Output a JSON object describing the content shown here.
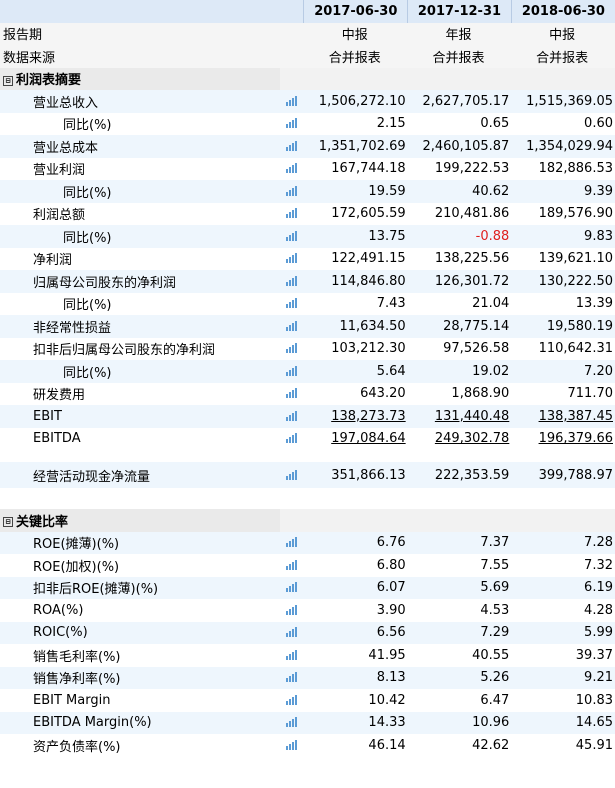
{
  "header": {
    "label": "报告期",
    "dates": [
      "2017-06-30",
      "2017-12-31",
      "2018-06-30"
    ]
  },
  "report_type": {
    "label": "报告期",
    "values": [
      "中报",
      "年报",
      "中报"
    ]
  },
  "data_source": {
    "label": "数据来源",
    "values": [
      "合并报表",
      "合并报表",
      "合并报表"
    ]
  },
  "income_section": {
    "toggle": "⊟",
    "title": "利润表摘要",
    "rows": [
      {
        "label": "营业总收入",
        "values": [
          "1,506,272.10",
          "2,627,705.17",
          "1,515,369.05"
        ]
      },
      {
        "label": "同比(%)",
        "values": [
          "2.15",
          "0.65",
          "0.60"
        ]
      },
      {
        "label": "营业总成本",
        "values": [
          "1,351,702.69",
          "2,460,105.87",
          "1,354,029.94"
        ]
      },
      {
        "label": "营业利润",
        "values": [
          "167,744.18",
          "199,222.53",
          "182,886.53"
        ]
      },
      {
        "label": "同比(%)",
        "values": [
          "19.59",
          "40.62",
          "9.39"
        ]
      },
      {
        "label": "利润总额",
        "values": [
          "172,605.59",
          "210,481.86",
          "189,576.90"
        ]
      },
      {
        "label": "同比(%)",
        "values": [
          "13.75",
          "-0.88",
          "9.83"
        ]
      },
      {
        "label": "净利润",
        "values": [
          "122,491.15",
          "138,225.56",
          "139,621.10"
        ]
      },
      {
        "label": "归属母公司股东的净利润",
        "values": [
          "114,846.80",
          "126,301.72",
          "130,222.50"
        ]
      },
      {
        "label": "同比(%)",
        "values": [
          "7.43",
          "21.04",
          "13.39"
        ]
      },
      {
        "label": "非经常性损益",
        "values": [
          "11,634.50",
          "28,775.14",
          "19,580.19"
        ]
      },
      {
        "label": "扣非后归属母公司股东的净利润",
        "values": [
          "103,212.30",
          "97,526.58",
          "110,642.31"
        ]
      },
      {
        "label": "同比(%)",
        "values": [
          "5.64",
          "19.02",
          "7.20"
        ]
      },
      {
        "label": "研发费用",
        "values": [
          "643.20",
          "1,868.90",
          "711.70"
        ]
      },
      {
        "label": "EBIT",
        "values": [
          "138,273.73",
          "131,440.48",
          "138,387.45"
        ]
      },
      {
        "label": "EBITDA",
        "values": [
          "197,084.64",
          "249,302.78",
          "196,379.66"
        ]
      }
    ]
  },
  "cashflow_row": {
    "label": "经营活动现金净流量",
    "values": [
      "351,866.13",
      "222,353.59",
      "399,788.97"
    ]
  },
  "ratio_section": {
    "toggle": "⊟",
    "title": "关键比率",
    "rows": [
      {
        "label": "ROE(摊薄)(%)",
        "values": [
          "6.76",
          "7.37",
          "7.28"
        ]
      },
      {
        "label": "ROE(加权)(%)",
        "values": [
          "6.80",
          "7.55",
          "7.32"
        ]
      },
      {
        "label": "扣非后ROE(摊薄)(%)",
        "values": [
          "6.07",
          "5.69",
          "6.19"
        ]
      },
      {
        "label": "ROA(%)",
        "values": [
          "3.90",
          "4.53",
          "4.28"
        ]
      },
      {
        "label": "ROIC(%)",
        "values": [
          "6.56",
          "7.29",
          "5.99"
        ]
      },
      {
        "label": "销售毛利率(%)",
        "values": [
          "41.95",
          "40.55",
          "39.37"
        ]
      },
      {
        "label": "销售净利率(%)",
        "values": [
          "8.13",
          "5.26",
          "9.21"
        ]
      },
      {
        "label": "EBIT Margin",
        "values": [
          "10.42",
          "6.47",
          "10.83"
        ]
      },
      {
        "label": "EBITDA Margin(%)",
        "values": [
          "14.33",
          "10.96",
          "14.65"
        ]
      },
      {
        "label": "资产负债率(%)",
        "values": [
          "46.14",
          "42.62",
          "45.91"
        ]
      }
    ]
  },
  "colors": {
    "header_bg": "#dde9f7",
    "stripe": "#eef6fd",
    "negative": "#e02020",
    "chart_icon": "#5b9bd5"
  },
  "icons": {
    "row_chart": "bar-chart-icon",
    "section_toggle": "collapse-icon"
  }
}
